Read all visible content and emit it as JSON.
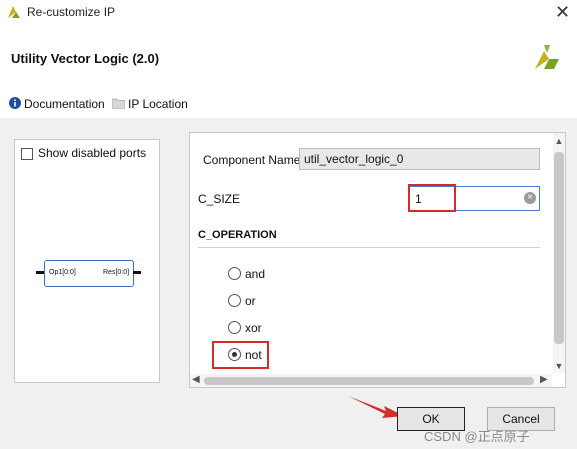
{
  "window": {
    "title": "Re-customize IP",
    "close_glyph": "✕"
  },
  "header": {
    "ip_name": "Utility Vector Logic (2.0)",
    "logo": "xilinx-logo-icon"
  },
  "toolbar": {
    "documentation": "Documentation",
    "ip_location": "IP Location"
  },
  "left_panel": {
    "show_disabled_ports": "Show disabled ports",
    "show_disabled_checked": false,
    "block": {
      "input_port": "Op1[0:0]",
      "output_port": "Res[0:0]"
    }
  },
  "config": {
    "component_name_label": "Component Name",
    "component_name_value": "util_vector_logic_0",
    "c_size_label": "C_SIZE",
    "c_size_value": "1",
    "c_operation_label": "C_OPERATION",
    "operations": [
      {
        "label": "and",
        "selected": false
      },
      {
        "label": "or",
        "selected": false
      },
      {
        "label": "xor",
        "selected": false
      },
      {
        "label": "not",
        "selected": true
      }
    ]
  },
  "buttons": {
    "ok": "OK",
    "cancel": "Cancel"
  },
  "watermark": "CSDN @正点原子",
  "colors": {
    "highlight": "#d62b2b",
    "focus": "#4a7bd8",
    "logo_yellow": "#c6b31b",
    "logo_green": "#7aa324"
  }
}
